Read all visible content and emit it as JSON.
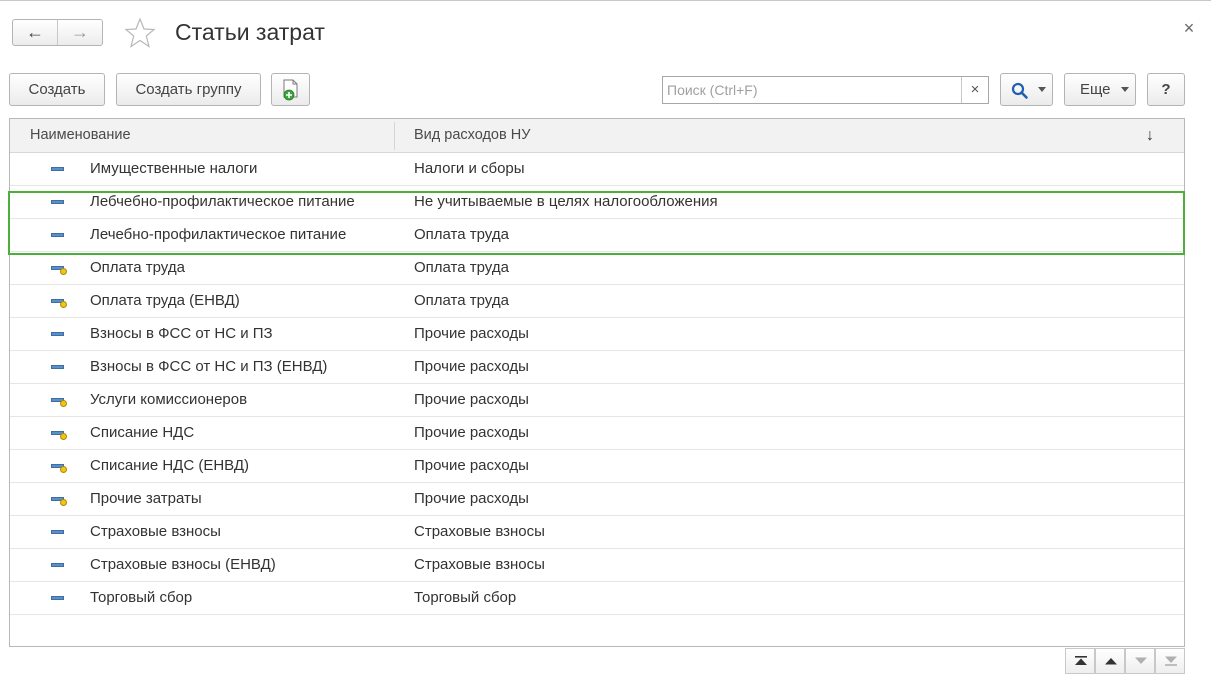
{
  "header": {
    "back_label": "←",
    "forward_label": "→",
    "title": "Статьи затрат",
    "close_label": "×"
  },
  "toolbar": {
    "create_label": "Создать",
    "create_group_label": "Создать группу",
    "search_placeholder": "Поиск (Ctrl+F)",
    "search_value": "",
    "clear_label": "×",
    "more_label": "Еще",
    "help_label": "?"
  },
  "table": {
    "columns": [
      "Наименование",
      "Вид расходов НУ"
    ],
    "sort_indicator": "↓",
    "rows": [
      {
        "name": "Имущественные налоги",
        "vid": "Налоги и сборы",
        "icon": "item-icon"
      },
      {
        "name": "Лебчебно-профилактическое питание",
        "vid": "Не учитываемые в целях налогообложения",
        "icon": "item-icon"
      },
      {
        "name": "Лечебно-профилактическое питание",
        "vid": "Оплата труда",
        "icon": "item-icon"
      },
      {
        "name": "Оплата труда",
        "vid": "Оплата труда",
        "icon": "predefined-item-icon"
      },
      {
        "name": "Оплата труда (ЕНВД)",
        "vid": "Оплата труда",
        "icon": "predefined-item-icon"
      },
      {
        "name": "Взносы в ФСС от НС и ПЗ",
        "vid": "Прочие расходы",
        "icon": "item-icon"
      },
      {
        "name": "Взносы в ФСС от НС и ПЗ (ЕНВД)",
        "vid": "Прочие расходы",
        "icon": "item-icon"
      },
      {
        "name": "Услуги комиссионеров",
        "vid": "Прочие расходы",
        "icon": "predefined-item-icon"
      },
      {
        "name": "Списание НДС",
        "vid": "Прочие расходы",
        "icon": "predefined-item-icon"
      },
      {
        "name": "Списание НДС (ЕНВД)",
        "vid": "Прочие расходы",
        "icon": "predefined-item-icon"
      },
      {
        "name": "Прочие затраты",
        "vid": "Прочие расходы",
        "icon": "predefined-item-icon"
      },
      {
        "name": "Страховые взносы",
        "vid": "Страховые взносы",
        "icon": "item-icon"
      },
      {
        "name": "Страховые взносы (ЕНВД)",
        "vid": "Страховые взносы",
        "icon": "item-icon"
      },
      {
        "name": "Торговый сбор",
        "vid": "Торговый сбор",
        "icon": "item-icon"
      }
    ]
  },
  "colors": {
    "highlight": "#4caf3a",
    "item_icon": "#5b8fc7",
    "predefined_dot": "#f0c419"
  }
}
